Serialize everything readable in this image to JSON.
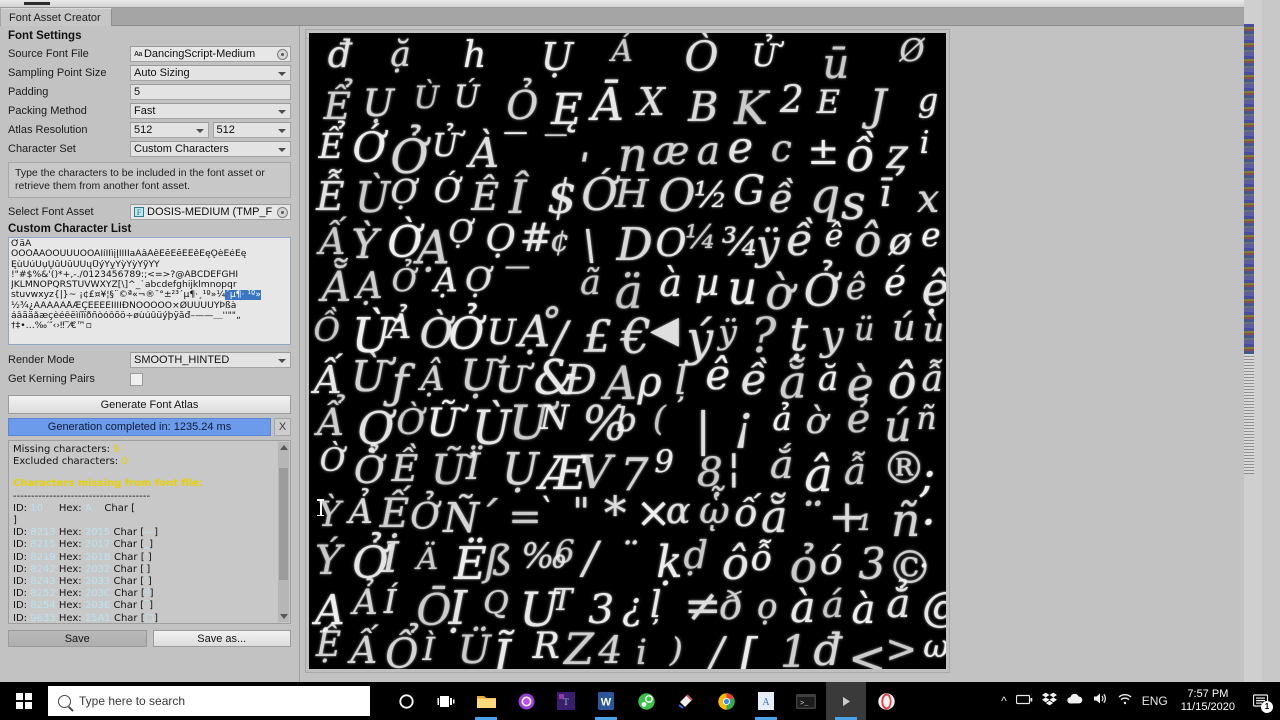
{
  "window": {
    "tab_label": "Font Asset Creator",
    "controls": {
      "menu": "⋮",
      "maximize": "□",
      "close": "✕"
    }
  },
  "panel": {
    "section_title": "Font Settings",
    "fields": [
      {
        "label": "Source Font File",
        "value": "DancingScript-Medium",
        "type": "object",
        "badge": "Aa"
      },
      {
        "label": "Sampling Point Size",
        "value": "Auto Sizing",
        "type": "dropdown"
      },
      {
        "label": "Padding",
        "value": "5",
        "type": "text"
      },
      {
        "label": "Packing Method",
        "value": "Fast",
        "type": "dropdown"
      },
      {
        "label": "Atlas Resolution",
        "value": "512",
        "value2": "512",
        "type": "dropdown-pair"
      },
      {
        "label": "Character Set",
        "value": "Custom Characters",
        "type": "dropdown"
      }
    ],
    "help_text": "Type the characters to be included in the font asset or retrieve them from another font asset.",
    "select_font_asset": {
      "label": "Select Font Asset",
      "value": "DOSIS-MEDIUM (TMP_F",
      "badge": "F"
    },
    "custom_character_list_title": "Custom Character List",
    "custom_character_lines": [
      "ƠäĀ",
      "ŎÒÓÅÃÕÔÙÚÛÒÓÃÌíÍÌìįĮIÏÍÏaAâÂêÊēĒēĒĒěĚęǪèÈéÉę",
      "ĘùÙúÚụŲūŪŭŬŰųŮýÝỵYỳŶỳŶỹŶŸ",
      "!\"#$%&'()*+,-./0123456789:;<=>?@ABCDEFGHI",
      "JKLMNOPQRSTUVWXYZ[\\]^_`abcdefghijklmnopqr",
      "stuvwxyz{|}~ ¡¢£¤¥¦§¨©ª«¬­®¯°±²³´µ¶·¸¹º»¼",
      "½¾¿ÀÁÂÃÄÅÆÇÈÉÊËÌÍÎÏÐÑÒÓÔÕÖ×ØÙÚÛÜÝÞßà",
      "áâãäåæçèéêëìíîïðñòóôõö÷øùúûüýþÿăđ–——＿''\"\"„",
      "†‡•…‰′″‹›‼‾⁄€™▫"
    ],
    "selection_text": "´µ¶· ¹º»",
    "render_mode": {
      "label": "Render Mode",
      "value": "SMOOTH_HINTED"
    },
    "kerning": {
      "label": "Get Kerning Pairs",
      "checked": false
    },
    "generate_button": "Generate Font Atlas",
    "progress": {
      "text": "Generation completed in: 1235.24 ms",
      "close": "X",
      "color": "#6b9bea"
    },
    "console": {
      "missing_label": "Missing characters:",
      "missing_count": "9",
      "excluded_label": "Excluded characters:",
      "excluded_count": "0",
      "warning_header": "Characters missing from font file:",
      "divider": "--------------------------------------",
      "rows": [
        {
          "id_label": "ID:",
          "id": "10",
          "hex_label": "Hex:",
          "hex": "A",
          "char_label": "Char [",
          "char": "",
          "close": ""
        },
        {
          "id_label": "",
          "id": "",
          "hex_label": "",
          "hex": "",
          "char_label": "]",
          "char": "",
          "close": ""
        },
        {
          "id_label": "ID:",
          "id": "8213",
          "hex_label": "Hex:",
          "hex": "2015",
          "char_label": "Char [",
          "char": "―",
          "close": "]"
        },
        {
          "id_label": "ID:",
          "id": "8215",
          "hex_label": "Hex:",
          "hex": "2017",
          "char_label": "Char [",
          "char": "‗",
          "close": "]"
        },
        {
          "id_label": "ID:",
          "id": "8219",
          "hex_label": "Hex:",
          "hex": "201B",
          "char_label": "Char [",
          "char": "‛",
          "close": "]"
        },
        {
          "id_label": "ID:",
          "id": "8242",
          "hex_label": "Hex:",
          "hex": "2032",
          "char_label": "Char [",
          "char": "′",
          "close": "]"
        },
        {
          "id_label": "ID:",
          "id": "8243",
          "hex_label": "Hex:",
          "hex": "2033",
          "char_label": "Char [",
          "char": "″",
          "close": "]"
        },
        {
          "id_label": "ID:",
          "id": "8252",
          "hex_label": "Hex:",
          "hex": "203C",
          "char_label": "Char [",
          "char": "‼",
          "close": "]"
        },
        {
          "id_label": "ID:",
          "id": "8254",
          "hex_label": "Hex:",
          "hex": "203E",
          "char_label": "Char [",
          "char": "‾",
          "close": "]"
        },
        {
          "id_label": "ID:",
          "id": "9633",
          "hex_label": "Hex:",
          "hex": "25A1",
          "char_label": "Char [",
          "char": "□",
          "close": "]"
        }
      ]
    },
    "save_button": "Save",
    "save_as_button": "Save as..."
  },
  "atlas": {
    "description": "Generated font atlas preview, white script glyphs on black background",
    "glyph_rows": [
      "đ ặ h Ụ Á Ò Ử ū Ø",
      "Ể Ụ Ù Ú Ỏ Ę Ā X B K 2 E J g",
      "Ể Ớ Ở Ử À ‾ ‾ ˌ n æ a e c ± ồ ȥ i",
      "Ễ Ù Ợ Ớ Ê Î $ Ớ H O ½ G ề q s ī x",
      "Ấ Ỳ Ờ Ạ Ợ Ọ # ¢ \\ D O ¼ ¾ ÿ ề ê ô ø e",
      "Ẵ Ạ Ở Ạ Ợ ‾ ˳ ã ä à µ u ờ Ở ê é ệ",
      "Ồ Ừ Ả Ờ Ở U Ạ / £ € ◀ ý ÿ ? ṭ y ü ú ù",
      "Ấ Ừ ƒ Ậ Ự Ư & Ð A ρ ļ ê ề ẵ ă è ô ẫ",
      "Ẩ Ợ Ờ Ữ Ù Ư N % b ( | ¡ ả ờ ẻ ú ñ",
      "Ờ Ở Ề Ữ Ï Ụ Æ V 7 9 8 ¦ ắ â ẫ ® ;",
      "Ỳ Ả Ế Ở Ñ ´ = ` \" * × ɑ ᾧ ố ẵ ¨ + ₁ ñ ·",
      "Ý Ở İ Ä Ë ß ‰ 6 / ¨ ḳ ḍ ô ỗ ỏ ó 3 © .",
      "Ạ Ả Í Ō Ị Q U T 3 ¿ ļ ≠ ð ọ à á à ẳ @",
      "Ệ Ấ Ổ Ì Ü Ĩ R Z 4 i ) / [ 1 đ < > ω"
    ]
  },
  "taskbar": {
    "search_placeholder": "Type here to search",
    "start": "windows-logo",
    "items": [
      "cortana-icon",
      "task-view-icon",
      "file-explorer-icon",
      "firefox-icon",
      "texstudio-icon",
      "word-icon",
      "steam-icon",
      "paint-icon",
      "chrome-icon",
      "reader-icon",
      "terminal-icon",
      "unity-icon",
      "opera-icon"
    ],
    "tray": {
      "chevron": "^",
      "battery": "battery-icon",
      "dropbox": "dropbox-icon",
      "onedrive": "onedrive-icon",
      "volume": "volume-icon",
      "wifi": "wifi-icon",
      "language": "ENG"
    },
    "time": "7:57 PM",
    "date": "11/15/2020",
    "notification_count": "1"
  }
}
